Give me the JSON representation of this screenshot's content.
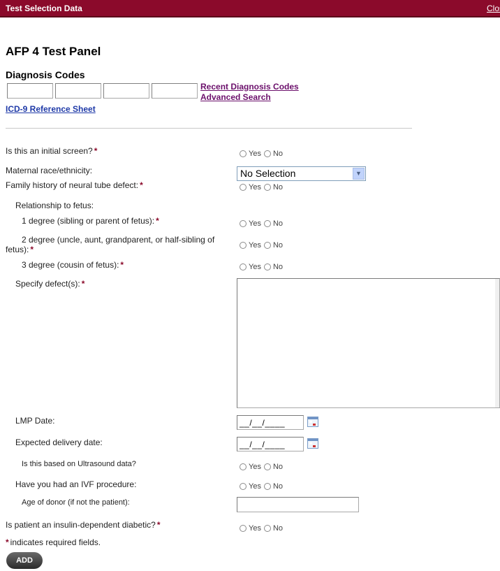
{
  "titlebar": {
    "title": "Test Selection Data",
    "close": "Close"
  },
  "panel_title": "AFP 4 Test Panel",
  "diagnosis": {
    "heading": "Diagnosis Codes",
    "recent_link": "Recent Diagnosis Codes",
    "advanced_link": "Advanced Search",
    "reference_link": "ICD-9 Reference Sheet"
  },
  "questions": {
    "initial_screen": "Is this an initial screen?",
    "maternal_race": "Maternal race/ethnicity:",
    "family_history": "Family history of neural tube defect:",
    "relationship": "Relationship to fetus:",
    "degree1": "1 degree (sibling or parent of fetus):",
    "degree2_line1": "2 degree (uncle, aunt, grandparent, or half-sibling of",
    "degree2_line2": "fetus):",
    "degree3": "3 degree (cousin of fetus):",
    "specify_defect": "Specify defect(s):",
    "lmp_date": "LMP Date:",
    "expected_delivery": "Expected delivery date:",
    "ultrasound": "Is this based on Ultrasound data?",
    "ivf": "Have you had an IVF procedure:",
    "donor_age": "Age of donor (if not the patient):",
    "insulin": "Is patient an insulin-dependent diabetic?"
  },
  "radio": {
    "yes": "Yes",
    "no": "No"
  },
  "maternal_race_select": {
    "selected": "No Selection"
  },
  "date_placeholder": "__/__/____",
  "required_star": "*",
  "required_note": "indicates required fields.",
  "add_button": "ADD"
}
